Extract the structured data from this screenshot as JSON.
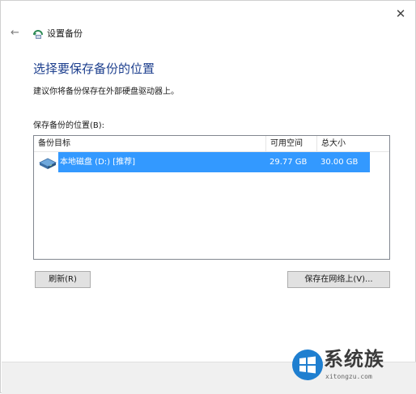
{
  "window": {
    "title": "设置备份",
    "close_glyph": "✕",
    "back_glyph": "←"
  },
  "page": {
    "heading": "选择要保存备份的位置",
    "instruction": "建议你将备份保存在外部硬盘驱动器上。",
    "list_label": "保存备份的位置(B):"
  },
  "listview": {
    "columns": [
      "备份目标",
      "可用空间",
      "总大小"
    ],
    "rows": [
      {
        "name": "本地磁盘 (D:) [推荐]",
        "free": "29.77 GB",
        "total": "30.00 GB",
        "icon": "hard-drive-icon",
        "selected": true
      }
    ]
  },
  "buttons": {
    "refresh": "刷新(R)",
    "save_network": "保存在网络上(V)..."
  },
  "watermark": {
    "text": "系统族",
    "url": "xitongzu.com"
  },
  "colors": {
    "heading": "#1d3f8e",
    "selection": "#3399ff",
    "footer": "#f0f0f0"
  }
}
